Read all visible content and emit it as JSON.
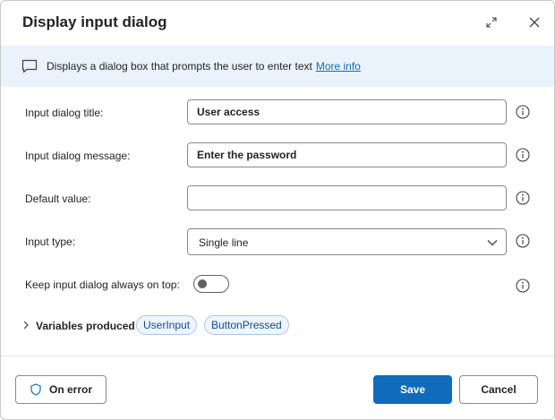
{
  "dialog": {
    "title": "Display input dialog"
  },
  "banner": {
    "text": "Displays a dialog box that prompts the user to enter text",
    "link": "More info"
  },
  "fields": {
    "title_label": "Input dialog title:",
    "title_value": "User access",
    "message_label": "Input dialog message:",
    "message_value": "Enter the password",
    "default_label": "Default value:",
    "default_value": "",
    "type_label": "Input type:",
    "type_value": "Single line",
    "ontop_label": "Keep input dialog always on top:",
    "ontop_checked": false
  },
  "variables": {
    "label": "Variables produced",
    "items": [
      "UserInput",
      "ButtonPressed"
    ]
  },
  "footer": {
    "on_error": "On error",
    "save": "Save",
    "cancel": "Cancel"
  },
  "colors": {
    "accent": "#0f6cbd",
    "banner_bg": "#eaf2fb",
    "pill_bg": "#eef5fc"
  }
}
